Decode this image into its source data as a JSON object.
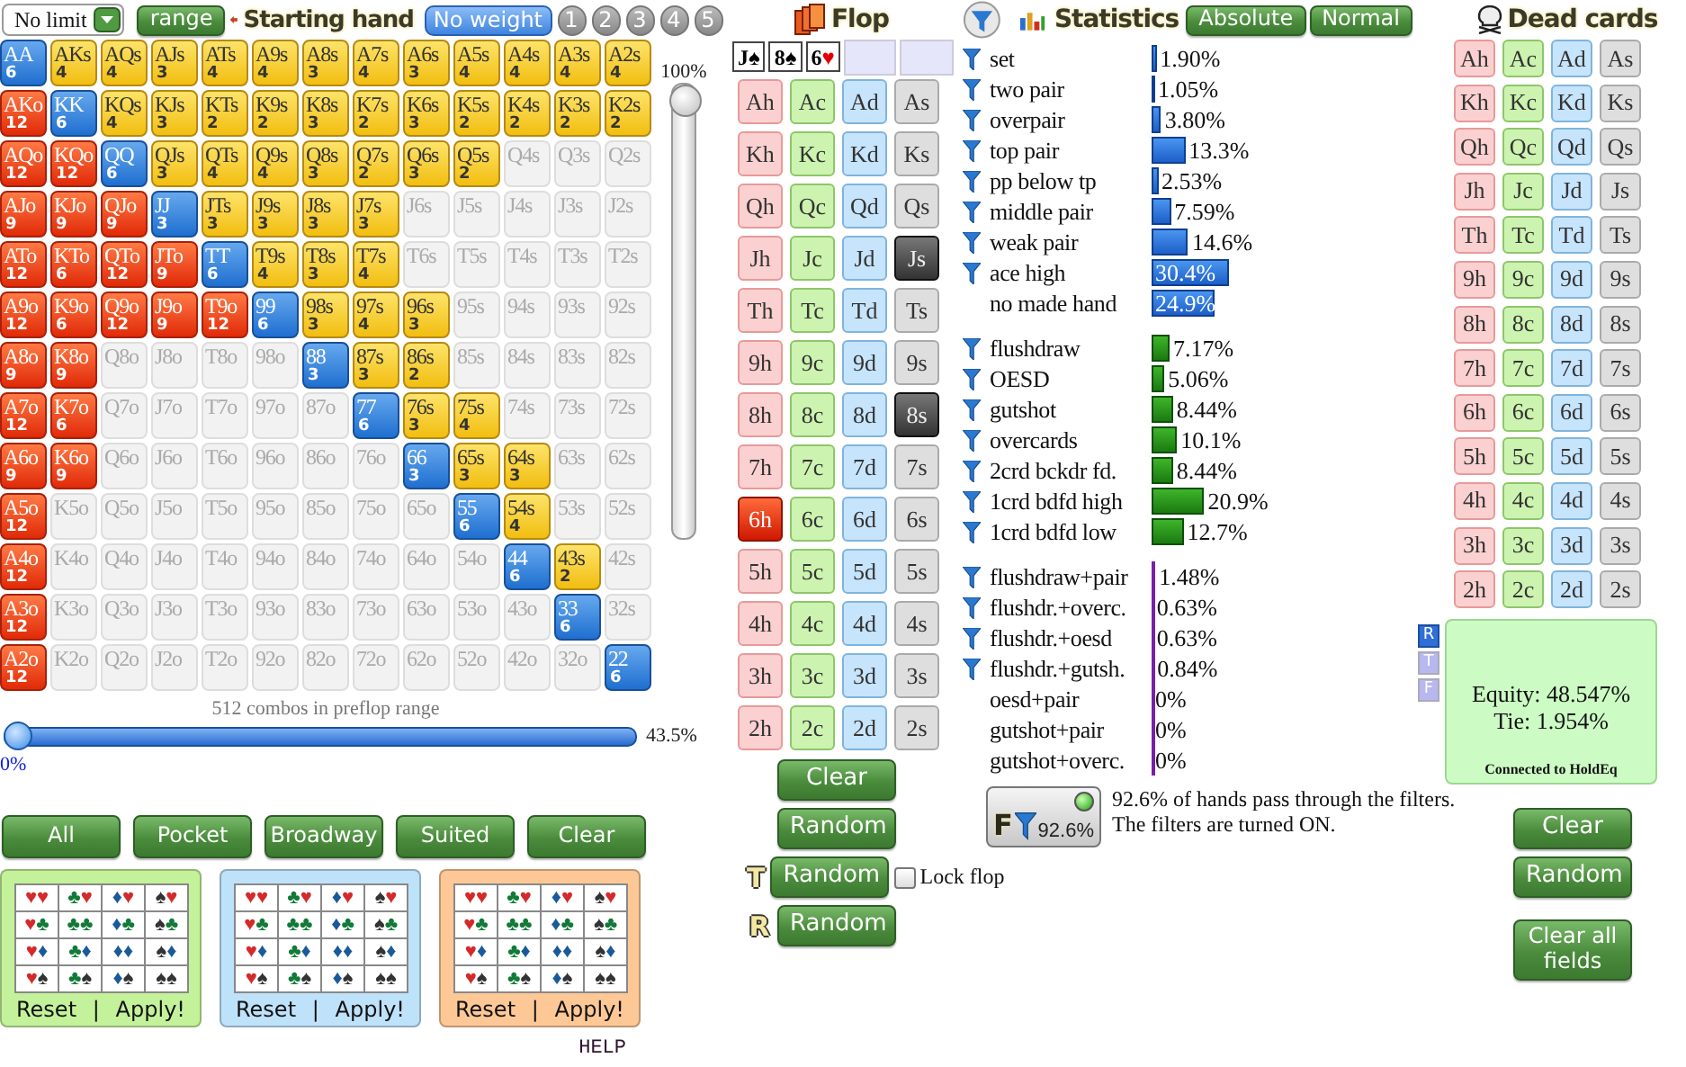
{
  "header": {
    "mode_select": {
      "value": "No limit"
    },
    "range_button": "range",
    "title": "Starting hand",
    "weights": [
      {
        "label": "No weight",
        "selected": true
      },
      {
        "label": "1",
        "selected": false
      },
      {
        "label": "2",
        "selected": false
      },
      {
        "label": "3",
        "selected": false
      },
      {
        "label": "4",
        "selected": false
      },
      {
        "label": "5",
        "selected": false
      }
    ]
  },
  "hand_grid": {
    "rows": [
      {
        "cells": [
          {
            "hand": "AA",
            "count": "6",
            "selected": true
          },
          {
            "hand": "AKs",
            "count": "4",
            "selected": true
          },
          {
            "hand": "AQs",
            "count": "4",
            "selected": true
          },
          {
            "hand": "AJs",
            "count": "3",
            "selected": true
          },
          {
            "hand": "ATs",
            "count": "4",
            "selected": true
          },
          {
            "hand": "A9s",
            "count": "4",
            "selected": true
          },
          {
            "hand": "A8s",
            "count": "3",
            "selected": true
          },
          {
            "hand": "A7s",
            "count": "4",
            "selected": true
          },
          {
            "hand": "A6s",
            "count": "3",
            "selected": true
          },
          {
            "hand": "A5s",
            "count": "4",
            "selected": true
          },
          {
            "hand": "A4s",
            "count": "4",
            "selected": true
          },
          {
            "hand": "A3s",
            "count": "4",
            "selected": true
          },
          {
            "hand": "A2s",
            "count": "4",
            "selected": true
          }
        ]
      },
      {
        "cells": [
          {
            "hand": "AKo",
            "count": "12",
            "selected": true
          },
          {
            "hand": "KK",
            "count": "6",
            "selected": true
          },
          {
            "hand": "KQs",
            "count": "4",
            "selected": true
          },
          {
            "hand": "KJs",
            "count": "3",
            "selected": true
          },
          {
            "hand": "KTs",
            "count": "2",
            "selected": true
          },
          {
            "hand": "K9s",
            "count": "2",
            "selected": true
          },
          {
            "hand": "K8s",
            "count": "3",
            "selected": true
          },
          {
            "hand": "K7s",
            "count": "2",
            "selected": true
          },
          {
            "hand": "K6s",
            "count": "3",
            "selected": true
          },
          {
            "hand": "K5s",
            "count": "2",
            "selected": true
          },
          {
            "hand": "K4s",
            "count": "2",
            "selected": true
          },
          {
            "hand": "K3s",
            "count": "2",
            "selected": true
          },
          {
            "hand": "K2s",
            "count": "2",
            "selected": true
          }
        ]
      },
      {
        "cells": [
          {
            "hand": "AQo",
            "count": "12",
            "selected": true
          },
          {
            "hand": "KQo",
            "count": "12",
            "selected": true
          },
          {
            "hand": "QQ",
            "count": "6",
            "selected": true
          },
          {
            "hand": "QJs",
            "count": "3",
            "selected": true
          },
          {
            "hand": "QTs",
            "count": "4",
            "selected": true
          },
          {
            "hand": "Q9s",
            "count": "4",
            "selected": true
          },
          {
            "hand": "Q8s",
            "count": "3",
            "selected": true
          },
          {
            "hand": "Q7s",
            "count": "2",
            "selected": true
          },
          {
            "hand": "Q6s",
            "count": "3",
            "selected": true
          },
          {
            "hand": "Q5s",
            "count": "2",
            "selected": true
          },
          {
            "hand": "Q4s",
            "selected": false
          },
          {
            "hand": "Q3s",
            "selected": false
          },
          {
            "hand": "Q2s",
            "selected": false
          }
        ]
      },
      {
        "cells": [
          {
            "hand": "AJo",
            "count": "9",
            "selected": true
          },
          {
            "hand": "KJo",
            "count": "9",
            "selected": true
          },
          {
            "hand": "QJo",
            "count": "9",
            "selected": true
          },
          {
            "hand": "JJ",
            "count": "3",
            "selected": true
          },
          {
            "hand": "JTs",
            "count": "3",
            "selected": true
          },
          {
            "hand": "J9s",
            "count": "3",
            "selected": true
          },
          {
            "hand": "J8s",
            "count": "3",
            "selected": true
          },
          {
            "hand": "J7s",
            "count": "3",
            "selected": true
          },
          {
            "hand": "J6s",
            "selected": false
          },
          {
            "hand": "J5s",
            "selected": false
          },
          {
            "hand": "J4s",
            "selected": false
          },
          {
            "hand": "J3s",
            "selected": false
          },
          {
            "hand": "J2s",
            "selected": false
          }
        ]
      },
      {
        "cells": [
          {
            "hand": "ATo",
            "count": "12",
            "selected": true
          },
          {
            "hand": "KTo",
            "count": "6",
            "selected": true
          },
          {
            "hand": "QTo",
            "count": "12",
            "selected": true
          },
          {
            "hand": "JTo",
            "count": "9",
            "selected": true
          },
          {
            "hand": "TT",
            "count": "6",
            "selected": true
          },
          {
            "hand": "T9s",
            "count": "4",
            "selected": true
          },
          {
            "hand": "T8s",
            "count": "3",
            "selected": true
          },
          {
            "hand": "T7s",
            "count": "4",
            "selected": true
          },
          {
            "hand": "T6s",
            "selected": false
          },
          {
            "hand": "T5s",
            "selected": false
          },
          {
            "hand": "T4s",
            "selected": false
          },
          {
            "hand": "T3s",
            "selected": false
          },
          {
            "hand": "T2s",
            "selected": false
          }
        ]
      },
      {
        "cells": [
          {
            "hand": "A9o",
            "count": "12",
            "selected": true
          },
          {
            "hand": "K9o",
            "count": "6",
            "selected": true
          },
          {
            "hand": "Q9o",
            "count": "12",
            "selected": true
          },
          {
            "hand": "J9o",
            "count": "9",
            "selected": true
          },
          {
            "hand": "T9o",
            "count": "12",
            "selected": true
          },
          {
            "hand": "99",
            "count": "6",
            "selected": true
          },
          {
            "hand": "98s",
            "count": "3",
            "selected": true
          },
          {
            "hand": "97s",
            "count": "4",
            "selected": true
          },
          {
            "hand": "96s",
            "count": "3",
            "selected": true
          },
          {
            "hand": "95s",
            "selected": false
          },
          {
            "hand": "94s",
            "selected": false
          },
          {
            "hand": "93s",
            "selected": false
          },
          {
            "hand": "92s",
            "selected": false
          }
        ]
      },
      {
        "cells": [
          {
            "hand": "A8o",
            "count": "9",
            "selected": true
          },
          {
            "hand": "K8o",
            "count": "9",
            "selected": true
          },
          {
            "hand": "Q8o",
            "selected": false
          },
          {
            "hand": "J8o",
            "selected": false
          },
          {
            "hand": "T8o",
            "selected": false
          },
          {
            "hand": "98o",
            "selected": false
          },
          {
            "hand": "88",
            "count": "3",
            "selected": true
          },
          {
            "hand": "87s",
            "count": "3",
            "selected": true
          },
          {
            "hand": "86s",
            "count": "2",
            "selected": true
          },
          {
            "hand": "85s",
            "selected": false
          },
          {
            "hand": "84s",
            "selected": false
          },
          {
            "hand": "83s",
            "selected": false
          },
          {
            "hand": "82s",
            "selected": false
          }
        ]
      },
      {
        "cells": [
          {
            "hand": "A7o",
            "count": "12",
            "selected": true
          },
          {
            "hand": "K7o",
            "count": "6",
            "selected": true
          },
          {
            "hand": "Q7o",
            "selected": false
          },
          {
            "hand": "J7o",
            "selected": false
          },
          {
            "hand": "T7o",
            "selected": false
          },
          {
            "hand": "97o",
            "selected": false
          },
          {
            "hand": "87o",
            "selected": false
          },
          {
            "hand": "77",
            "count": "6",
            "selected": true
          },
          {
            "hand": "76s",
            "count": "3",
            "selected": true
          },
          {
            "hand": "75s",
            "count": "4",
            "selected": true
          },
          {
            "hand": "74s",
            "selected": false
          },
          {
            "hand": "73s",
            "selected": false
          },
          {
            "hand": "72s",
            "selected": false
          }
        ]
      },
      {
        "cells": [
          {
            "hand": "A6o",
            "count": "9",
            "selected": true
          },
          {
            "hand": "K6o",
            "count": "9",
            "selected": true
          },
          {
            "hand": "Q6o",
            "selected": false
          },
          {
            "hand": "J6o",
            "selected": false
          },
          {
            "hand": "T6o",
            "selected": false
          },
          {
            "hand": "96o",
            "selected": false
          },
          {
            "hand": "86o",
            "selected": false
          },
          {
            "hand": "76o",
            "selected": false
          },
          {
            "hand": "66",
            "count": "3",
            "selected": true
          },
          {
            "hand": "65s",
            "count": "3",
            "selected": true
          },
          {
            "hand": "64s",
            "count": "3",
            "selected": true
          },
          {
            "hand": "63s",
            "selected": false
          },
          {
            "hand": "62s",
            "selected": false
          }
        ]
      },
      {
        "cells": [
          {
            "hand": "A5o",
            "count": "12",
            "selected": true
          },
          {
            "hand": "K5o",
            "selected": false
          },
          {
            "hand": "Q5o",
            "selected": false
          },
          {
            "hand": "J5o",
            "selected": false
          },
          {
            "hand": "T5o",
            "selected": false
          },
          {
            "hand": "95o",
            "selected": false
          },
          {
            "hand": "85o",
            "selected": false
          },
          {
            "hand": "75o",
            "selected": false
          },
          {
            "hand": "65o",
            "selected": false
          },
          {
            "hand": "55",
            "count": "6",
            "selected": true
          },
          {
            "hand": "54s",
            "count": "4",
            "selected": true
          },
          {
            "hand": "53s",
            "selected": false
          },
          {
            "hand": "52s",
            "selected": false
          }
        ]
      },
      {
        "cells": [
          {
            "hand": "A4o",
            "count": "12",
            "selected": true
          },
          {
            "hand": "K4o",
            "selected": false
          },
          {
            "hand": "Q4o",
            "selected": false
          },
          {
            "hand": "J4o",
            "selected": false
          },
          {
            "hand": "T4o",
            "selected": false
          },
          {
            "hand": "94o",
            "selected": false
          },
          {
            "hand": "84o",
            "selected": false
          },
          {
            "hand": "74o",
            "selected": false
          },
          {
            "hand": "64o",
            "selected": false
          },
          {
            "hand": "54o",
            "selected": false
          },
          {
            "hand": "44",
            "count": "6",
            "selected": true
          },
          {
            "hand": "43s",
            "count": "2",
            "selected": true
          },
          {
            "hand": "42s",
            "selected": false
          }
        ]
      },
      {
        "cells": [
          {
            "hand": "A3o",
            "count": "12",
            "selected": true
          },
          {
            "hand": "K3o",
            "selected": false
          },
          {
            "hand": "Q3o",
            "selected": false
          },
          {
            "hand": "J3o",
            "selected": false
          },
          {
            "hand": "T3o",
            "selected": false
          },
          {
            "hand": "93o",
            "selected": false
          },
          {
            "hand": "83o",
            "selected": false
          },
          {
            "hand": "73o",
            "selected": false
          },
          {
            "hand": "63o",
            "selected": false
          },
          {
            "hand": "53o",
            "selected": false
          },
          {
            "hand": "43o",
            "selected": false
          },
          {
            "hand": "33",
            "count": "6",
            "selected": true
          },
          {
            "hand": "32s",
            "selected": false
          }
        ]
      },
      {
        "cells": [
          {
            "hand": "A2o",
            "count": "12",
            "selected": true
          },
          {
            "hand": "K2o",
            "selected": false
          },
          {
            "hand": "Q2o",
            "selected": false
          },
          {
            "hand": "J2o",
            "selected": false
          },
          {
            "hand": "T2o",
            "selected": false
          },
          {
            "hand": "92o",
            "selected": false
          },
          {
            "hand": "82o",
            "selected": false
          },
          {
            "hand": "72o",
            "selected": false
          },
          {
            "hand": "62o",
            "selected": false
          },
          {
            "hand": "52o",
            "selected": false
          },
          {
            "hand": "42o",
            "selected": false
          },
          {
            "hand": "32o",
            "selected": false
          },
          {
            "hand": "22",
            "count": "6",
            "selected": true
          }
        ]
      }
    ],
    "vertical_slider": {
      "reading": "100%",
      "level": 1
    },
    "combos_text": "512 combos in preflop range",
    "range_slider": {
      "reading": "43.5%",
      "min_label": "0%",
      "level": 0
    }
  },
  "presets": [
    "All",
    "Pocket",
    "Broadway",
    "Suited",
    "Clear"
  ],
  "suit_panels": [
    {
      "color": "#c4f29a",
      "rows": [
        [
          [
            "♥",
            "♥"
          ],
          [
            "♣",
            "♥"
          ],
          [
            "♦",
            "♥"
          ],
          [
            "♠",
            "♥"
          ]
        ],
        [
          [
            "♥",
            "♣"
          ],
          [
            "♣",
            "♣"
          ],
          [
            "♦",
            "♣"
          ],
          [
            "♠",
            "♣"
          ]
        ],
        [
          [
            "♥",
            "♦"
          ],
          [
            "♣",
            "♦"
          ],
          [
            "♦",
            "♦"
          ],
          [
            "♠",
            "♦"
          ]
        ],
        [
          [
            "♥",
            "♠"
          ],
          [
            "♣",
            "♠"
          ],
          [
            "♦",
            "♠"
          ],
          [
            "♠",
            "♠"
          ]
        ]
      ],
      "reset": "Reset",
      "separator": "|",
      "apply": "Apply!"
    },
    {
      "color": "#bfe2fb",
      "rows": [
        [
          [
            "♥",
            "♥"
          ],
          [
            "♣",
            "♥"
          ],
          [
            "♦",
            "♥"
          ],
          [
            "♠",
            "♥"
          ]
        ],
        [
          [
            "♥",
            "♣"
          ],
          [
            "♣",
            "♣"
          ],
          [
            "♦",
            "♣"
          ],
          [
            "♠",
            "♣"
          ]
        ],
        [
          [
            "♥",
            "♦"
          ],
          [
            "♣",
            "♦"
          ],
          [
            "♦",
            "♦"
          ],
          [
            "♠",
            "♦"
          ]
        ],
        [
          [
            "♥",
            "♠"
          ],
          [
            "♣",
            "♠"
          ],
          [
            "♦",
            "♠"
          ],
          [
            "♠",
            "♠"
          ]
        ]
      ],
      "reset": "Reset",
      "separator": "|",
      "apply": "Apply!"
    },
    {
      "color": "#fdc896",
      "rows": [
        [
          [
            "♥",
            "♥"
          ],
          [
            "♣",
            "♥"
          ],
          [
            "♦",
            "♥"
          ],
          [
            "♠",
            "♥"
          ]
        ],
        [
          [
            "♥",
            "♣"
          ],
          [
            "♣",
            "♣"
          ],
          [
            "♦",
            "♣"
          ],
          [
            "♠",
            "♣"
          ]
        ],
        [
          [
            "♥",
            "♦"
          ],
          [
            "♣",
            "♦"
          ],
          [
            "♦",
            "♦"
          ],
          [
            "♠",
            "♦"
          ]
        ],
        [
          [
            "♥",
            "♠"
          ],
          [
            "♣",
            "♠"
          ],
          [
            "♦",
            "♠"
          ],
          [
            "♠",
            "♠"
          ]
        ]
      ],
      "reset": "Reset",
      "separator": "|",
      "apply": "Apply!"
    }
  ],
  "help": "HELP",
  "flop": {
    "title": "Flop",
    "board": [
      {
        "kind": "black",
        "rank": "J",
        "suit": "♠"
      },
      {
        "kind": "black",
        "rank": "8",
        "suit": "♠"
      },
      {
        "kind": "red",
        "rank": "6",
        "suit": "♥"
      },
      {
        "kind": "empty"
      },
      {
        "kind": "empty"
      }
    ],
    "deck": [
      [
        {
          "label": "Ah",
          "selected": false
        },
        {
          "label": "Ac",
          "selected": false
        },
        {
          "label": "Ad",
          "selected": false
        },
        {
          "label": "As",
          "selected": false
        }
      ],
      [
        {
          "label": "Kh",
          "selected": false
        },
        {
          "label": "Kc",
          "selected": false
        },
        {
          "label": "Kd",
          "selected": false
        },
        {
          "label": "Ks",
          "selected": false
        }
      ],
      [
        {
          "label": "Qh",
          "selected": false
        },
        {
          "label": "Qc",
          "selected": false
        },
        {
          "label": "Qd",
          "selected": false
        },
        {
          "label": "Qs",
          "selected": false
        }
      ],
      [
        {
          "label": "Jh",
          "selected": false
        },
        {
          "label": "Jc",
          "selected": false
        },
        {
          "label": "Jd",
          "selected": false
        },
        {
          "label": "Js",
          "selected": true
        }
      ],
      [
        {
          "label": "Th",
          "selected": false
        },
        {
          "label": "Tc",
          "selected": false
        },
        {
          "label": "Td",
          "selected": false
        },
        {
          "label": "Ts",
          "selected": false
        }
      ],
      [
        {
          "label": "9h",
          "selected": false
        },
        {
          "label": "9c",
          "selected": false
        },
        {
          "label": "9d",
          "selected": false
        },
        {
          "label": "9s",
          "selected": false
        }
      ],
      [
        {
          "label": "8h",
          "selected": false
        },
        {
          "label": "8c",
          "selected": false
        },
        {
          "label": "8d",
          "selected": false
        },
        {
          "label": "8s",
          "selected": true
        }
      ],
      [
        {
          "label": "7h",
          "selected": false
        },
        {
          "label": "7c",
          "selected": false
        },
        {
          "label": "7d",
          "selected": false
        },
        {
          "label": "7s",
          "selected": false
        }
      ],
      [
        {
          "label": "6h",
          "selected": true
        },
        {
          "label": "6c",
          "selected": false
        },
        {
          "label": "6d",
          "selected": false
        },
        {
          "label": "6s",
          "selected": false
        }
      ],
      [
        {
          "label": "5h",
          "selected": false
        },
        {
          "label": "5c",
          "selected": false
        },
        {
          "label": "5d",
          "selected": false
        },
        {
          "label": "5s",
          "selected": false
        }
      ],
      [
        {
          "label": "4h",
          "selected": false
        },
        {
          "label": "4c",
          "selected": false
        },
        {
          "label": "4d",
          "selected": false
        },
        {
          "label": "4s",
          "selected": false
        }
      ],
      [
        {
          "label": "3h",
          "selected": false
        },
        {
          "label": "3c",
          "selected": false
        },
        {
          "label": "3d",
          "selected": false
        },
        {
          "label": "3s",
          "selected": false
        }
      ],
      [
        {
          "label": "2h",
          "selected": false
        },
        {
          "label": "2c",
          "selected": false
        },
        {
          "label": "2d",
          "selected": false
        },
        {
          "label": "2s",
          "selected": false
        }
      ]
    ],
    "clear": "Clear",
    "random": "Random",
    "turn": {
      "marker": "T",
      "button": "Random",
      "lock": {
        "label": "Lock flop",
        "checked": false
      }
    },
    "river": {
      "marker": "R",
      "button": "Random"
    }
  },
  "statistics": {
    "title": "Statistics",
    "modes": [
      "Absolute",
      "Normal"
    ],
    "groups": [
      {
        "kind": "made",
        "rows": [
          {
            "label": "set",
            "filter": true,
            "value": "1.90%"
          },
          {
            "label": "two pair",
            "filter": true,
            "value": "1.05%"
          },
          {
            "label": "overpair",
            "filter": true,
            "value": "3.80%"
          },
          {
            "label": "top pair",
            "filter": true,
            "value": "13.3%"
          },
          {
            "label": "pp below tp",
            "filter": true,
            "value": "2.53%"
          },
          {
            "label": "middle pair",
            "filter": true,
            "value": "7.59%"
          },
          {
            "label": "weak pair",
            "filter": true,
            "value": "14.6%"
          },
          {
            "label": "ace high",
            "filter": true,
            "value": "30.4%"
          },
          {
            "label": "no made hand",
            "filter": false,
            "value": "24.9%"
          }
        ]
      },
      {
        "kind": "draw",
        "rows": [
          {
            "label": "flushdraw",
            "filter": true,
            "value": "7.17%"
          },
          {
            "label": "OESD",
            "filter": true,
            "value": "5.06%"
          },
          {
            "label": "gutshot",
            "filter": true,
            "value": "8.44%"
          },
          {
            "label": "overcards",
            "filter": true,
            "value": "10.1%"
          },
          {
            "label": "2crd bckdr fd.",
            "filter": true,
            "value": "8.44%"
          },
          {
            "label": "1crd bdfd high",
            "filter": true,
            "value": "20.9%"
          },
          {
            "label": "1crd bdfd low",
            "filter": true,
            "value": "12.7%"
          }
        ]
      },
      {
        "kind": "combo",
        "rows": [
          {
            "label": "flushdraw+pair",
            "filter": true,
            "value": "1.48%"
          },
          {
            "label": "flushdr.+overc.",
            "filter": true,
            "value": "0.63%"
          },
          {
            "label": "flushdr.+oesd",
            "filter": true,
            "value": "0.63%"
          },
          {
            "label": "flushdr.+gutsh.",
            "filter": true,
            "value": "0.84%"
          },
          {
            "label": "oesd+pair",
            "filter": false,
            "value": "0%"
          },
          {
            "label": "gutshot+pair",
            "filter": false,
            "value": "0%"
          },
          {
            "label": "gutshot+overc.",
            "filter": false,
            "value": "0%"
          }
        ]
      }
    ],
    "filter_summary": {
      "button_label": "F",
      "reading": "92.6%",
      "on": true,
      "lines": [
        "92.6% of hands pass through the filters.",
        "The filters are turned ON."
      ]
    }
  },
  "dead_cards": {
    "title": "Dead cards",
    "deck": [
      [
        {
          "label": "Ah",
          "selected": false
        },
        {
          "label": "Ac",
          "selected": false
        },
        {
          "label": "Ad",
          "selected": false
        },
        {
          "label": "As",
          "selected": false
        }
      ],
      [
        {
          "label": "Kh",
          "selected": false
        },
        {
          "label": "Kc",
          "selected": false
        },
        {
          "label": "Kd",
          "selected": false
        },
        {
          "label": "Ks",
          "selected": false
        }
      ],
      [
        {
          "label": "Qh",
          "selected": false
        },
        {
          "label": "Qc",
          "selected": false
        },
        {
          "label": "Qd",
          "selected": false
        },
        {
          "label": "Qs",
          "selected": false
        }
      ],
      [
        {
          "label": "Jh",
          "selected": false
        },
        {
          "label": "Jc",
          "selected": false
        },
        {
          "label": "Jd",
          "selected": false
        },
        {
          "label": "Js",
          "selected": false
        }
      ],
      [
        {
          "label": "Th",
          "selected": false
        },
        {
          "label": "Tc",
          "selected": false
        },
        {
          "label": "Td",
          "selected": false
        },
        {
          "label": "Ts",
          "selected": false
        }
      ],
      [
        {
          "label": "9h",
          "selected": false
        },
        {
          "label": "9c",
          "selected": false
        },
        {
          "label": "9d",
          "selected": false
        },
        {
          "label": "9s",
          "selected": false
        }
      ],
      [
        {
          "label": "8h",
          "selected": false
        },
        {
          "label": "8c",
          "selected": false
        },
        {
          "label": "8d",
          "selected": false
        },
        {
          "label": "8s",
          "selected": false
        }
      ],
      [
        {
          "label": "7h",
          "selected": false
        },
        {
          "label": "7c",
          "selected": false
        },
        {
          "label": "7d",
          "selected": false
        },
        {
          "label": "7s",
          "selected": false
        }
      ],
      [
        {
          "label": "6h",
          "selected": false
        },
        {
          "label": "6c",
          "selected": false
        },
        {
          "label": "6d",
          "selected": false
        },
        {
          "label": "6s",
          "selected": false
        }
      ],
      [
        {
          "label": "5h",
          "selected": false
        },
        {
          "label": "5c",
          "selected": false
        },
        {
          "label": "5d",
          "selected": false
        },
        {
          "label": "5s",
          "selected": false
        }
      ],
      [
        {
          "label": "4h",
          "selected": false
        },
        {
          "label": "4c",
          "selected": false
        },
        {
          "label": "4d",
          "selected": false
        },
        {
          "label": "4s",
          "selected": false
        }
      ],
      [
        {
          "label": "3h",
          "selected": false
        },
        {
          "label": "3c",
          "selected": false
        },
        {
          "label": "3d",
          "selected": false
        },
        {
          "label": "3s",
          "selected": false
        }
      ],
      [
        {
          "label": "2h",
          "selected": false
        },
        {
          "label": "2c",
          "selected": false
        },
        {
          "label": "2d",
          "selected": false
        },
        {
          "label": "2s",
          "selected": false
        }
      ]
    ],
    "street_tabs": [
      {
        "label": "R",
        "selected": true
      },
      {
        "label": "T",
        "selected": false
      },
      {
        "label": "F",
        "selected": false
      }
    ],
    "equity": {
      "equity": "Equity: 48.547%",
      "tie": "Tie: 1.954%",
      "status": "Connected to HoldEq"
    },
    "buttons": [
      "Clear",
      "Random",
      "Clear all fields"
    ]
  }
}
